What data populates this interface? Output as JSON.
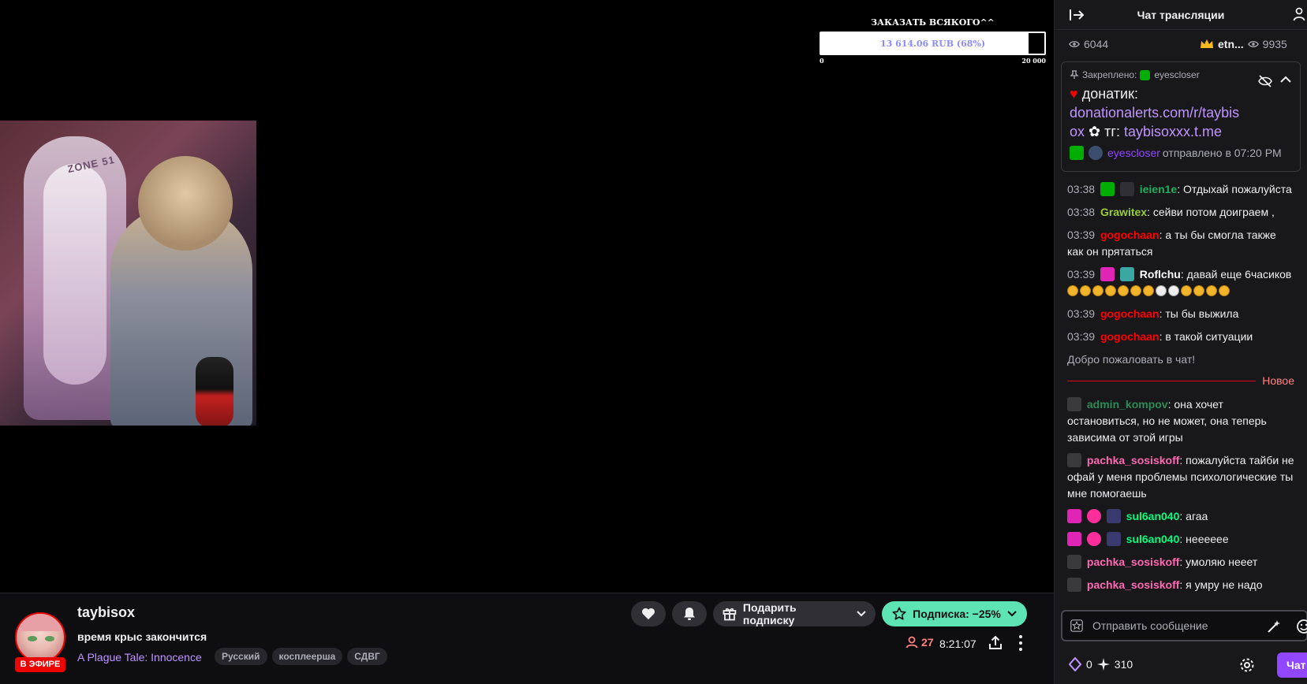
{
  "goal": {
    "title": "ЗАКАЗАТЬ ВСЯКОГО^^",
    "amount_text": "13 614.06 RUB (68%)",
    "progress": 0.68,
    "scale_min": "0",
    "scale_max": "20 000"
  },
  "channel": {
    "name": "taybisox",
    "live_badge": "В ЭФИРЕ",
    "title": "время крыс закончится",
    "game": "A Plague Tale: Innocence",
    "tags": [
      "Русский",
      "косплеерша",
      "СДВГ"
    ],
    "viewers": "27",
    "uptime": "8:21:07"
  },
  "actions": {
    "gift_label": "Подарить подписку",
    "subscribe_label": "Подписка: −25%"
  },
  "colors": {
    "accent": "#9147ff",
    "link": "#bf94ff",
    "live": "#eb0400",
    "subscribe": "#5ee4b4",
    "chat_bg": "#18181b"
  },
  "chat": {
    "header_title": "Чат трансляции",
    "viewers_left": "6044",
    "top_user": "etn...",
    "viewers_right": "9935",
    "pinned": {
      "label": "Закреплено:",
      "pinned_by": "eyescloser",
      "text_prefix": "донатик:",
      "link1": "donationalerts.com/r/taybis",
      "link1b": "ox",
      "tg_label": "тг:",
      "link2": "taybisoxxx.t.me",
      "author": "eyescloser",
      "sent_text": "отправлено в 07:20 PM"
    },
    "messages": [
      {
        "time": "03:38",
        "user": "ieien1e",
        "color": "#1fae5e",
        "text": ": Отдыхай пожалуйста"
      },
      {
        "time": "03:38",
        "user": "Grawitex",
        "color": "#9acd32",
        "text": ": сейви потом доиграем ,"
      },
      {
        "time": "03:39",
        "user": "gogochaan",
        "color": "#ff0000",
        "text": ": а ты бы смогла также как он прятаться"
      },
      {
        "time": "03:39",
        "user": "Roflchu",
        "color": "#ffffff",
        "text": ": давай еще 6часиков"
      },
      {
        "time": "03:39",
        "user": "gogochaan",
        "color": "#ff0000",
        "text": ": ты бы выжила"
      },
      {
        "time": "03:39",
        "user": "gogochaan",
        "color": "#ff0000",
        "text": ": в такой ситуации"
      }
    ],
    "welcome": "Добро пожаловать в чат!",
    "new_label": "Новое",
    "new_messages": [
      {
        "user": "admin_kompov",
        "color": "#2e8b57",
        "text": ": она хочет остановиться, но не может, она теперь зависима от этой игры"
      },
      {
        "user": "pachka_sosiskoff",
        "color": "#ff69b4",
        "text": ": пожалуйста тайби не офай у меня проблемы психологические ты мне помогаешь"
      },
      {
        "user": "sul6an040",
        "color": "#00ff7f",
        "text": ": агаа"
      },
      {
        "user": "sul6an040",
        "color": "#00ff7f",
        "text": ": неееееe"
      },
      {
        "user": "pachka_sosiskoff",
        "color": "#ff69b4",
        "text": ": умоляю нееет"
      },
      {
        "user": "pachka_sosiskoff",
        "color": "#ff69b4",
        "text": ": я умру не надо"
      }
    ],
    "input_placeholder": "Отправить сообщение",
    "points_value": "0",
    "sparks_value": "310",
    "send_label": "Чат"
  }
}
